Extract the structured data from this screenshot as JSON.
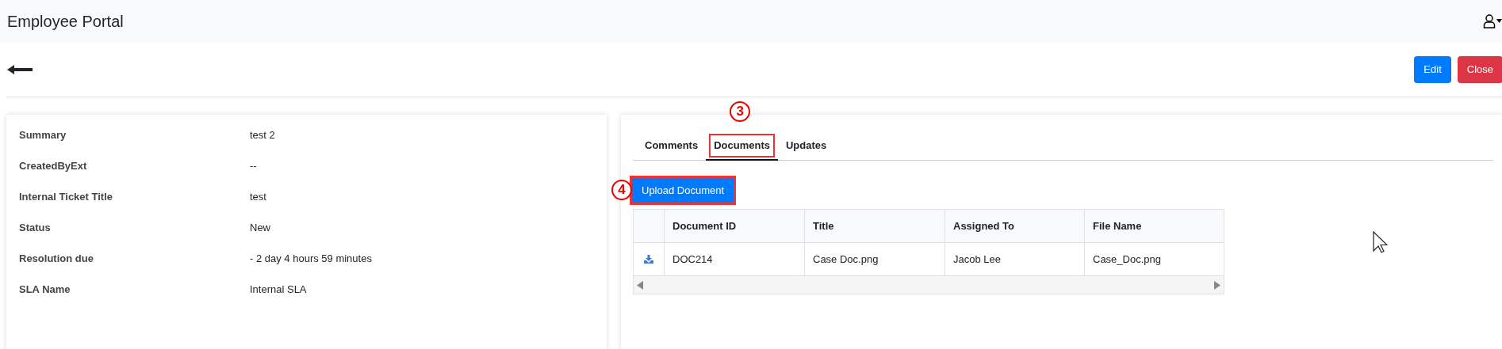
{
  "navbar": {
    "title": "Employee Portal"
  },
  "toolbar": {
    "buttons": [
      {
        "label": "Edit",
        "kind": "primary"
      },
      {
        "label": "Close",
        "kind": "danger"
      }
    ]
  },
  "details": [
    {
      "label": "Summary",
      "value": "test 2"
    },
    {
      "label": "CreatedByExt",
      "value": "--"
    },
    {
      "label": "Internal Ticket Title",
      "value": "test"
    },
    {
      "label": "Status",
      "value": "New"
    },
    {
      "label": "Resolution due",
      "value": "- 2 day 4 hours 59 minutes"
    },
    {
      "label": "SLA Name",
      "value": "Internal SLA"
    }
  ],
  "tabs": [
    {
      "label": "Comments",
      "selected": false
    },
    {
      "label": "Documents",
      "selected": true,
      "annotation": "3"
    },
    {
      "label": "Updates",
      "selected": false
    }
  ],
  "upload_button": {
    "label": "Upload Document",
    "annotation": "4"
  },
  "table": {
    "columns": [
      "Document ID",
      "Title",
      "Assigned To",
      "File Name"
    ],
    "rows": [
      [
        "DOC214",
        "Case Doc.png",
        "Jacob Lee",
        "Case_Doc.png"
      ]
    ]
  }
}
